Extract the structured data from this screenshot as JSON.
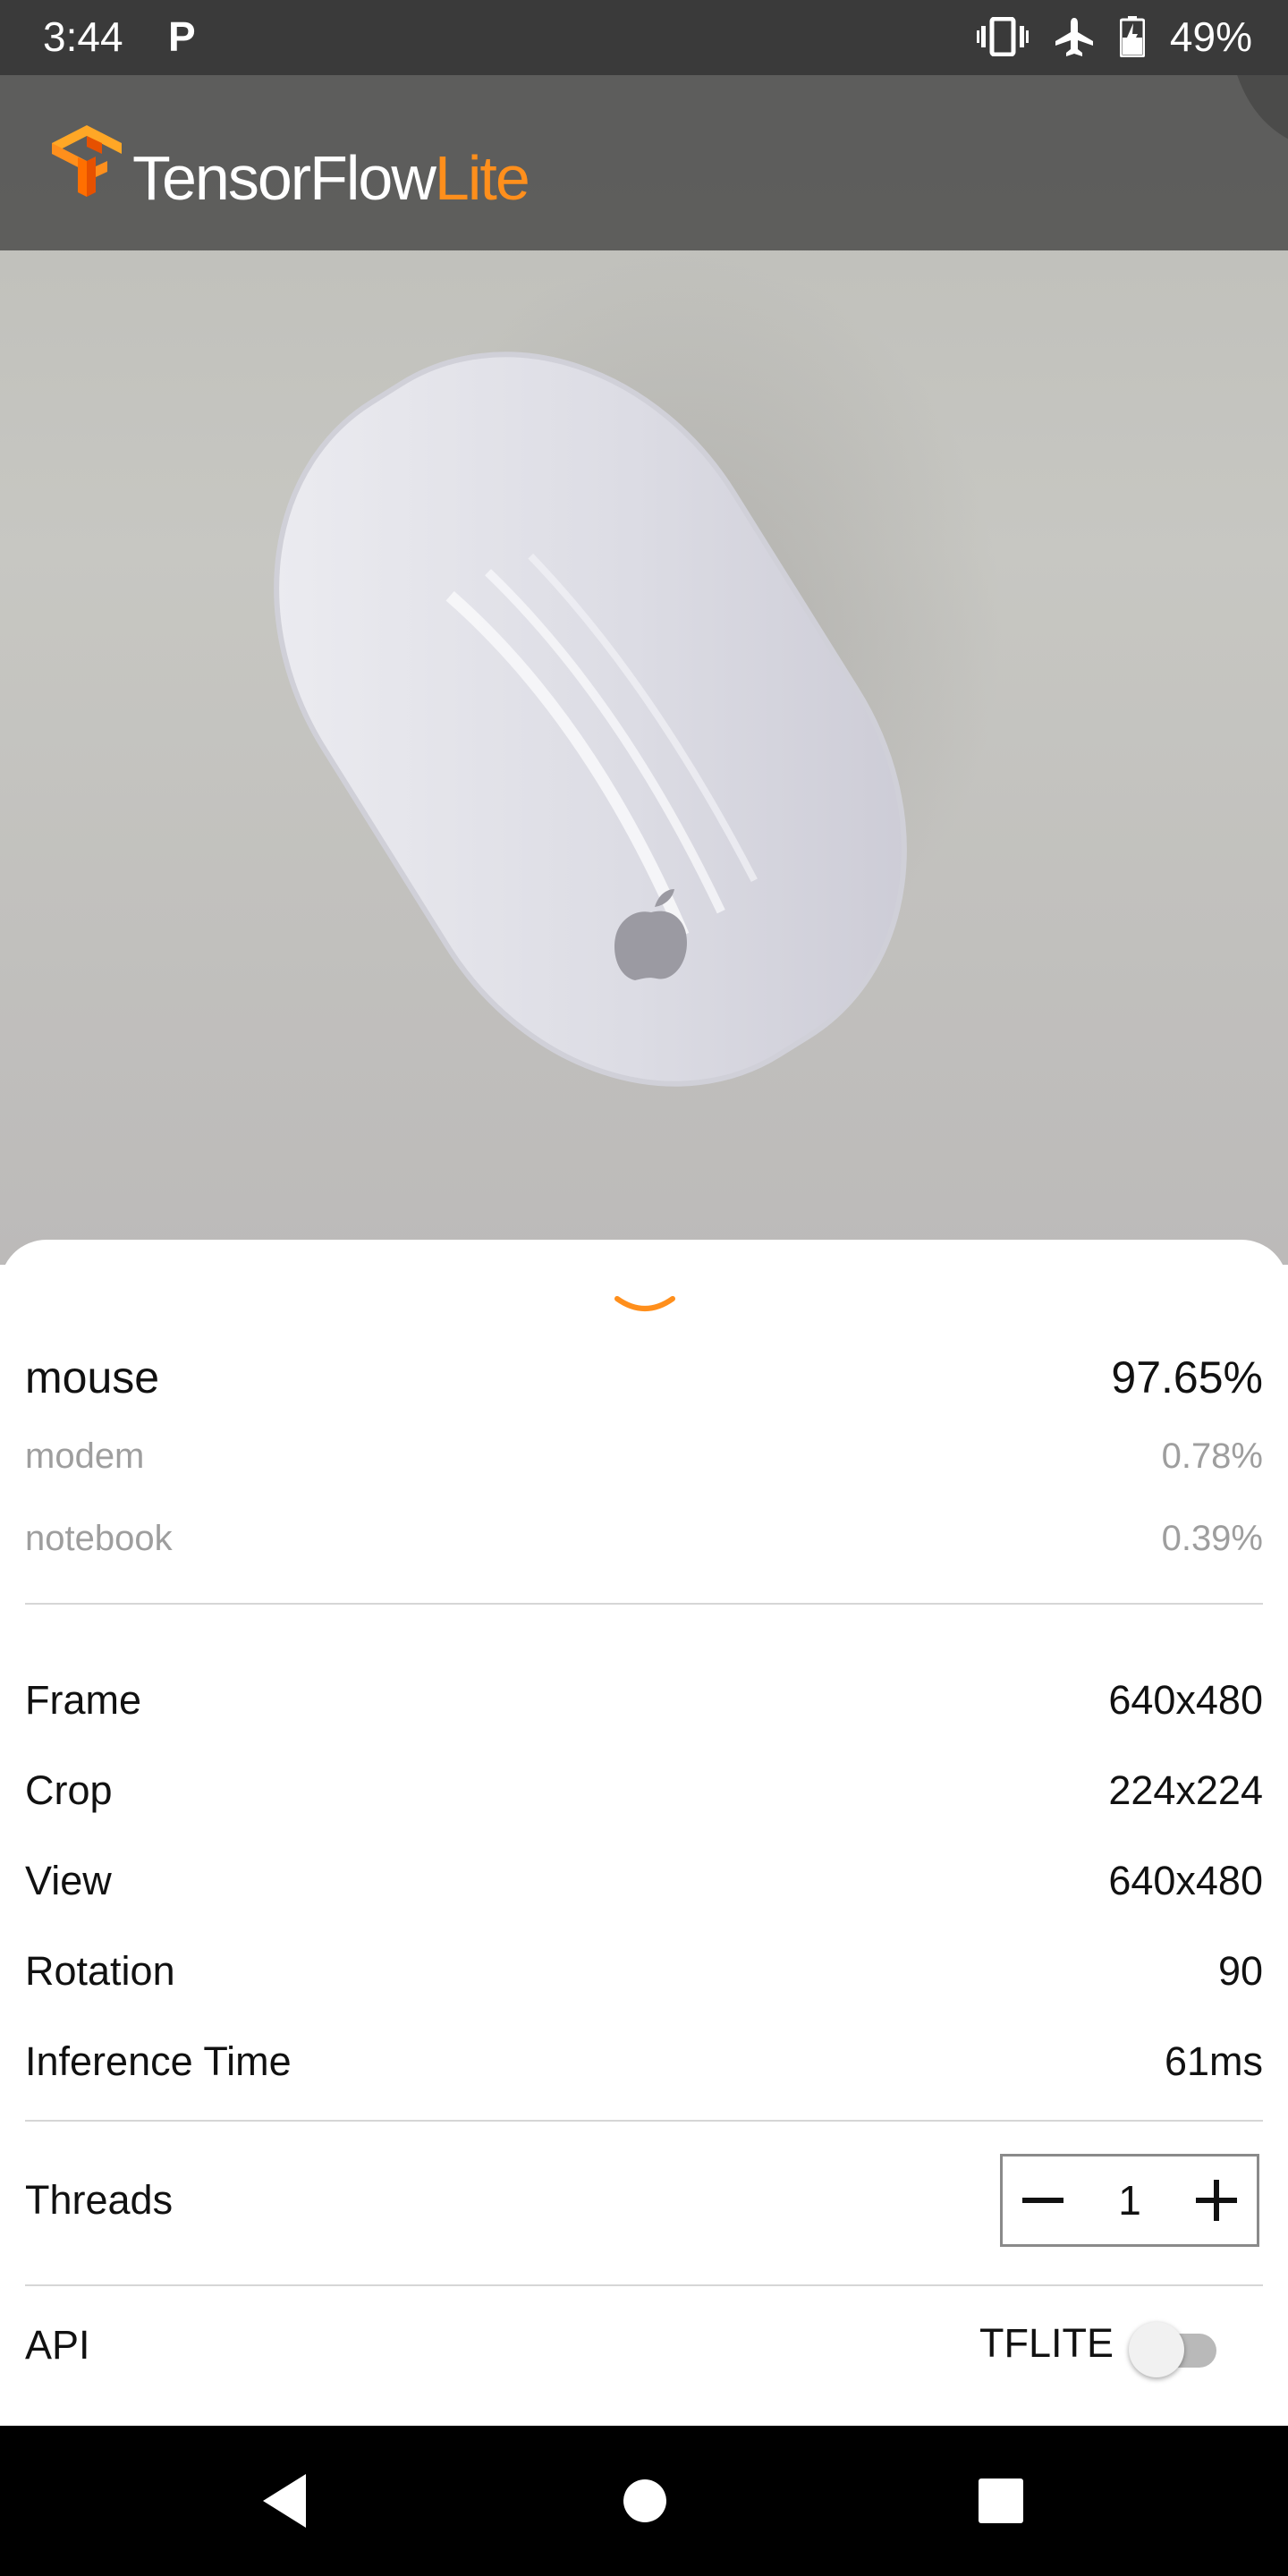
{
  "status_bar": {
    "time": "3:44",
    "notification": "P",
    "battery": "49%",
    "icons": [
      "vibrate-icon",
      "airplane-mode-icon",
      "battery-icon"
    ]
  },
  "app_bar": {
    "title_main": "TensorFlow",
    "title_accent": "Lite",
    "accent_color": "#ff8f1c",
    "logo": "tensorflow-logo"
  },
  "results": {
    "top": {
      "label": "mouse",
      "value": "97.65%"
    },
    "others": [
      {
        "label": "modem",
        "value": "0.78%"
      },
      {
        "label": "notebook",
        "value": "0.39%"
      }
    ]
  },
  "info": [
    {
      "label": "Frame",
      "value": "640x480"
    },
    {
      "label": "Crop",
      "value": "224x224"
    },
    {
      "label": "View",
      "value": "640x480"
    },
    {
      "label": "Rotation",
      "value": "90"
    },
    {
      "label": "Inference Time",
      "value": "61ms"
    }
  ],
  "threads": {
    "label": "Threads",
    "value": "1",
    "decrement_icon": "minus-icon",
    "increment_icon": "plus-icon"
  },
  "api": {
    "label": "API",
    "value": "TFLITE",
    "toggle_on": false
  },
  "nav_bar": {
    "icons": [
      "back-icon",
      "home-icon",
      "recents-icon"
    ]
  }
}
